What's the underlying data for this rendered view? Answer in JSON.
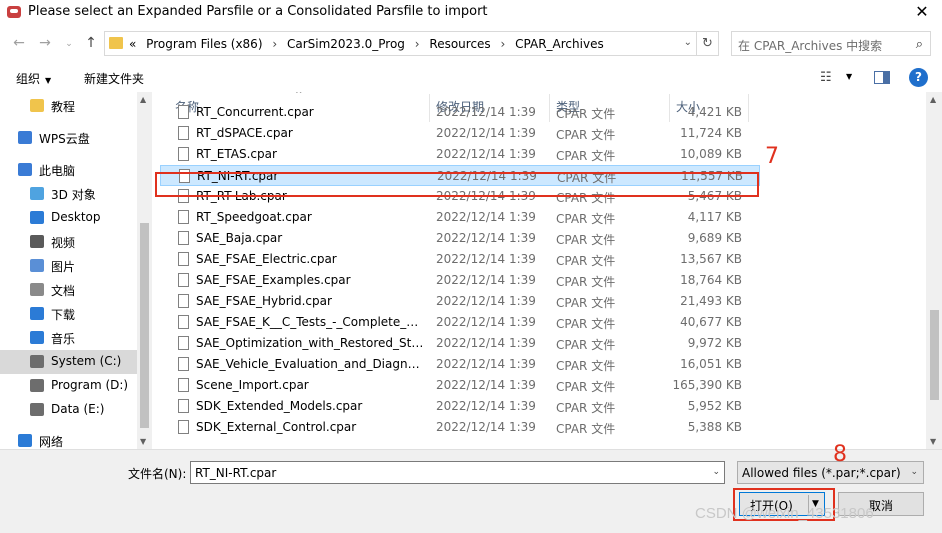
{
  "window": {
    "title": "Please select an Expanded Parsfile or a Consolidated Parsfile to import",
    "close_glyph": "✕"
  },
  "address": {
    "prefix": "«",
    "crumbs": [
      "Program Files (x86)",
      "CarSim2023.0_Prog",
      "Resources",
      "CPAR_Archives"
    ],
    "separator": "›",
    "search_placeholder": "在 CPAR_Archives 中搜索"
  },
  "toolbar": {
    "organize": "组织",
    "new_folder": "新建文件夹"
  },
  "nav": {
    "items": [
      {
        "label": "教程",
        "icon": "folder-icon",
        "color": "#f0c44c"
      },
      {
        "label": "WPS云盘",
        "icon": "cloud-icon",
        "color": "#3a7bd5"
      },
      {
        "label": "此电脑",
        "icon": "computer-icon",
        "color": "#3a7bd5"
      },
      {
        "label": "3D 对象",
        "icon": "cube-icon",
        "color": "#4fa3e0"
      },
      {
        "label": "Desktop",
        "icon": "desktop-icon",
        "color": "#2b7bd6"
      },
      {
        "label": "视频",
        "icon": "video-icon",
        "color": "#5a5a5a"
      },
      {
        "label": "图片",
        "icon": "picture-icon",
        "color": "#5a8fd6"
      },
      {
        "label": "文档",
        "icon": "document-icon",
        "color": "#8a8a8a"
      },
      {
        "label": "下载",
        "icon": "download-icon",
        "color": "#2b7bd6"
      },
      {
        "label": "音乐",
        "icon": "music-icon",
        "color": "#2b7bd6"
      },
      {
        "label": "System (C:)",
        "icon": "drive-icon",
        "color": "#6d6d6d"
      },
      {
        "label": "Program (D:)",
        "icon": "drive-icon",
        "color": "#6d6d6d"
      },
      {
        "label": "Data (E:)",
        "icon": "drive-icon",
        "color": "#6d6d6d"
      },
      {
        "label": "网络",
        "icon": "network-icon",
        "color": "#2b7bd6"
      }
    ],
    "selected": "System (C:)"
  },
  "columns": {
    "name": "名称",
    "date": "修改日期",
    "type": "类型",
    "size": "大小"
  },
  "files": [
    {
      "name": "RT_Concurrent.cpar",
      "date": "2022/12/14 1:39",
      "type": "CPAR 文件",
      "size": "4,421 KB"
    },
    {
      "name": "RT_dSPACE.cpar",
      "date": "2022/12/14 1:39",
      "type": "CPAR 文件",
      "size": "11,724 KB"
    },
    {
      "name": "RT_ETAS.cpar",
      "date": "2022/12/14 1:39",
      "type": "CPAR 文件",
      "size": "10,089 KB"
    },
    {
      "name": "RT_NI-RT.cpar",
      "date": "2022/12/14 1:39",
      "type": "CPAR 文件",
      "size": "11,557 KB",
      "selected": true
    },
    {
      "name": "RT_RT-Lab.cpar",
      "date": "2022/12/14 1:39",
      "type": "CPAR 文件",
      "size": "5,467 KB"
    },
    {
      "name": "RT_Speedgoat.cpar",
      "date": "2022/12/14 1:39",
      "type": "CPAR 文件",
      "size": "4,117 KB"
    },
    {
      "name": "SAE_Baja.cpar",
      "date": "2022/12/14 1:39",
      "type": "CPAR 文件",
      "size": "9,689 KB"
    },
    {
      "name": "SAE_FSAE_Electric.cpar",
      "date": "2022/12/14 1:39",
      "type": "CPAR 文件",
      "size": "13,567 KB"
    },
    {
      "name": "SAE_FSAE_Examples.cpar",
      "date": "2022/12/14 1:39",
      "type": "CPAR 文件",
      "size": "18,764 KB"
    },
    {
      "name": "SAE_FSAE_Hybrid.cpar",
      "date": "2022/12/14 1:39",
      "type": "CPAR 文件",
      "size": "21,493 KB"
    },
    {
      "name": "SAE_FSAE_K__C_Tests_-_Complete_Se...",
      "date": "2022/12/14 1:39",
      "type": "CPAR 文件",
      "size": "40,677 KB"
    },
    {
      "name": "SAE_Optimization_with_Restored_Stat...",
      "date": "2022/12/14 1:39",
      "type": "CPAR 文件",
      "size": "9,972 KB"
    },
    {
      "name": "SAE_Vehicle_Evaluation_and_Diagnost...",
      "date": "2022/12/14 1:39",
      "type": "CPAR 文件",
      "size": "16,051 KB"
    },
    {
      "name": "Scene_Import.cpar",
      "date": "2022/12/14 1:39",
      "type": "CPAR 文件",
      "size": "165,390 KB"
    },
    {
      "name": "SDK_Extended_Models.cpar",
      "date": "2022/12/14 1:39",
      "type": "CPAR 文件",
      "size": "5,952 KB"
    },
    {
      "name": "SDK_External_Control.cpar",
      "date": "2022/12/14 1:39",
      "type": "CPAR 文件",
      "size": "5,388 KB"
    }
  ],
  "annotations": {
    "step_files": "7",
    "step_open": "8",
    "color": "#e0311e"
  },
  "footer": {
    "filename_label": "文件名(N):",
    "filename_value": "RT_NI-RT.cpar",
    "filter_value": "Allowed files (*.par;*.cpar)",
    "open_label": "打开(O)",
    "cancel_label": "取消"
  },
  "watermark": "CSDN @weixin_43531806"
}
